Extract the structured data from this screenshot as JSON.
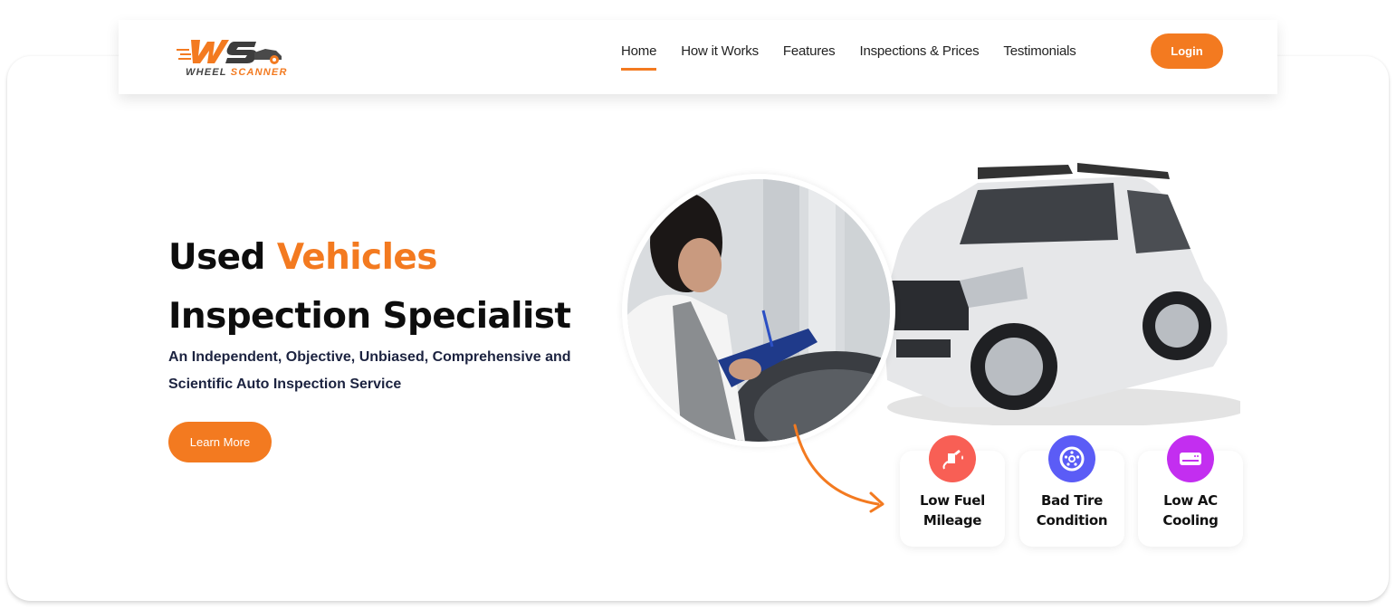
{
  "brand": {
    "logo_mark": "WS",
    "name_part1": "WHEEL",
    "name_part2": "SCANNER",
    "accent_color": "#f37a20"
  },
  "nav": {
    "items": [
      {
        "label": "Home",
        "active": true
      },
      {
        "label": "How it Works",
        "active": false
      },
      {
        "label": "Features",
        "active": false
      },
      {
        "label": "Inspections & Prices",
        "active": false
      },
      {
        "label": "Testimonials",
        "active": false
      }
    ],
    "login_label": "Login"
  },
  "hero": {
    "title_part1": "Used ",
    "title_accent": "Vehicles",
    "title_part2": " Inspection Specialist",
    "subtitle": "An Independent, Objective, Unbiased, Comprehensive and Scientific Auto Inspection Service",
    "cta_label": "Learn More",
    "photo_alt": "Mechanic inspecting a car with a clipboard",
    "car_alt": "Silver SUV"
  },
  "features": [
    {
      "label_line1": "Low Fuel",
      "label_line2": "Mileage",
      "icon": "fuel-pump-icon",
      "color": "#f85f55"
    },
    {
      "label_line1": "Bad Tire",
      "label_line2": "Condition",
      "icon": "tire-icon",
      "color": "#5b5cf6"
    },
    {
      "label_line1": "Low AC",
      "label_line2": "Cooling",
      "icon": "air-conditioner-icon",
      "color": "#c32ef0"
    }
  ]
}
